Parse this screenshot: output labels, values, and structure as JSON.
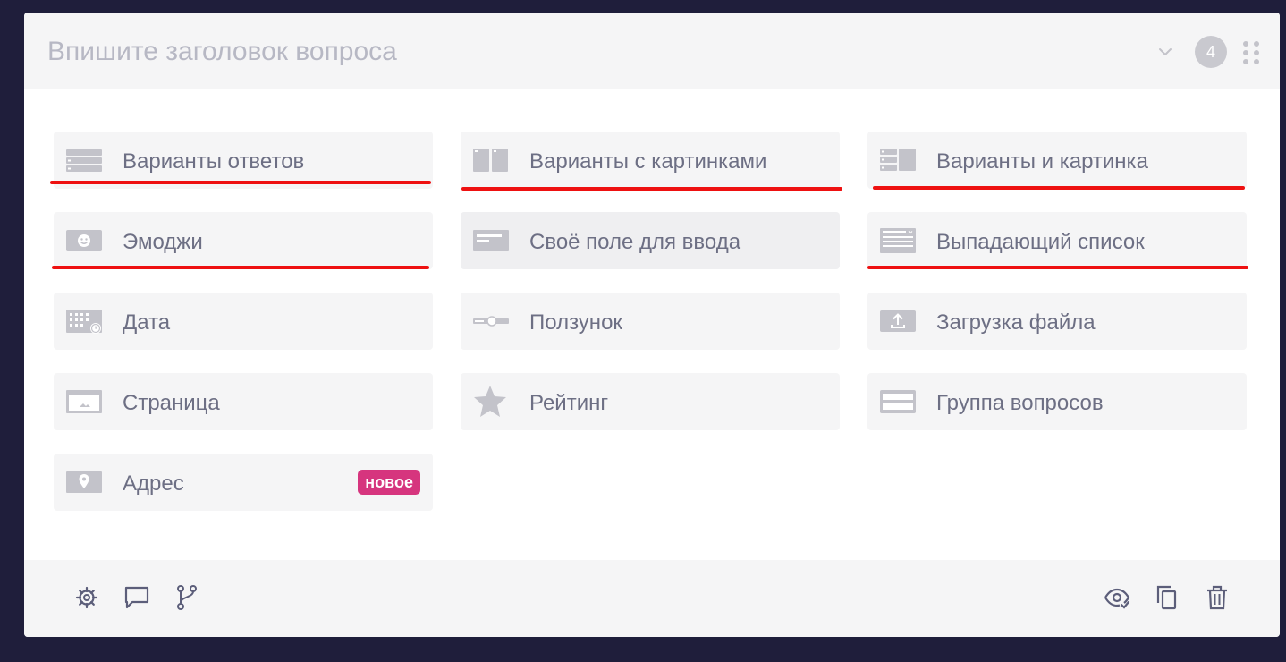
{
  "header": {
    "title_placeholder": "Впишите заголовок вопроса",
    "question_number": "4"
  },
  "question_types": [
    {
      "label": "Варианты ответов",
      "icon": "list-icon"
    },
    {
      "label": "Варианты с картинками",
      "icon": "image-cards-icon"
    },
    {
      "label": "Варианты и картинка",
      "icon": "list-with-image-icon"
    },
    {
      "label": "Эмоджи",
      "icon": "emoji-icon"
    },
    {
      "label": "Своё поле для ввода",
      "icon": "text-field-icon"
    },
    {
      "label": "Выпадающий список",
      "icon": "dropdown-list-icon"
    },
    {
      "label": "Дата",
      "icon": "calendar-icon"
    },
    {
      "label": "Ползунок",
      "icon": "slider-icon"
    },
    {
      "label": "Загрузка файла",
      "icon": "upload-icon"
    },
    {
      "label": "Страница",
      "icon": "page-icon"
    },
    {
      "label": "Рейтинг",
      "icon": "star-icon"
    },
    {
      "label": "Группа вопросов",
      "icon": "question-group-icon"
    },
    {
      "label": "Адрес",
      "icon": "map-pin-icon",
      "badge": "новое"
    }
  ],
  "footer": {
    "left_icons": [
      "settings-icon",
      "comment-icon",
      "branch-logic-icon"
    ],
    "right_icons": [
      "preview-eye-icon",
      "copy-icon",
      "trash-icon"
    ]
  },
  "colors": {
    "background": "#1f1e3b",
    "item_bg": "#f5f5f6",
    "text": "#6d6f84",
    "icon": "#c3c3ca",
    "new_badge": "#d6357e",
    "highlight_underline": "#ee1111",
    "footer_icon": "#5c5e7a"
  }
}
